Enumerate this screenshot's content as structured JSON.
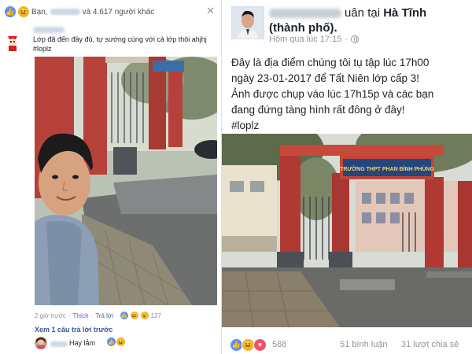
{
  "left": {
    "reactions_line": {
      "prefix": "Bạn,",
      "suffix": "và 4.617 người khác"
    },
    "close_glyph": "✕",
    "comment": {
      "text_line1": "Lớp đã đến đầy đủ, tự sướng cùng với cả lớp thôi ahjhj",
      "text_line2": "#loplz"
    },
    "actions": {
      "time": "2 giờ trước",
      "like_label": "Thích",
      "reply_label": "Trả lời",
      "reaction_count": "137"
    },
    "view_previous": "Xem 1 câu trả lời trước",
    "reply": {
      "text": "Hay lắm"
    }
  },
  "right": {
    "header": {
      "name_visible_suffix": "uân",
      "at_label": "tại",
      "place": "Hà Tĩnh",
      "place_line2": "(thành phố).",
      "time": "Hôm qua lúc 17:15",
      "dot": "·"
    },
    "post_lines": [
      "Đây là địa điểm chúng tôi tụ tập lúc 17h00",
      "ngày 23-01-2017 để Tất Niên lớp cấp 3!",
      "Ảnh được chụp vào lúc 17h15p và các bạn",
      "đang đứng tàng hình rất đông ở đây!",
      "#loplz"
    ],
    "gate_sign": "TRƯỜNG THPT PHAN ĐÌNH PHÙNG",
    "footer": {
      "reaction_count": "588",
      "comments": "51 bình luận",
      "shares": "31 lượt chia sẻ"
    }
  },
  "colors": {
    "like": "#5890ff",
    "haha": "#f7b125",
    "love": "#f25268",
    "link": "#365899",
    "meta": "#90949c"
  },
  "icons": {
    "like": "thumbs-up-icon",
    "haha": "haha-emoji-icon",
    "love": "heart-icon",
    "wow": "wow-emoji-icon",
    "globe": "globe-icon"
  }
}
